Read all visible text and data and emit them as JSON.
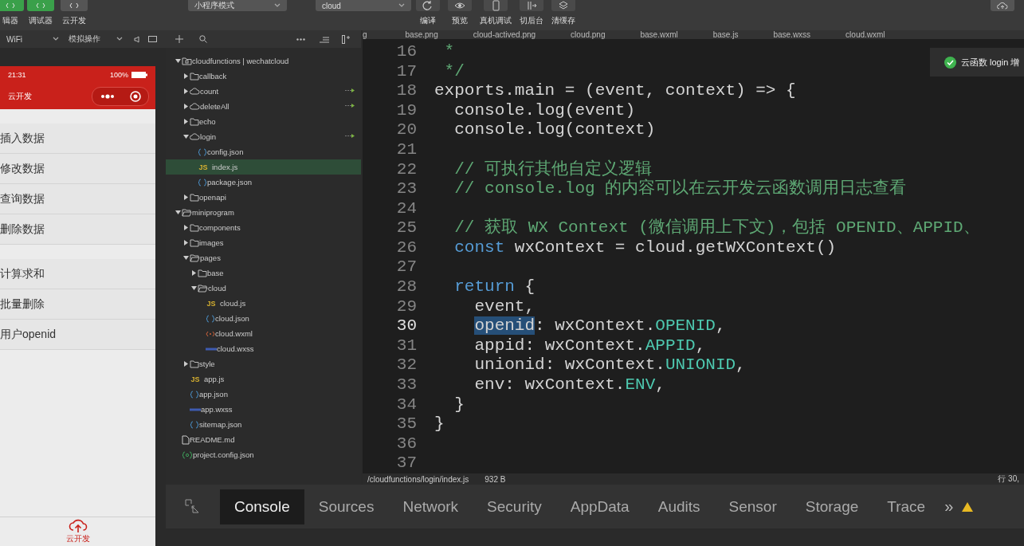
{
  "toolbar": {
    "buttons": [
      {
        "label": "辑器",
        "kind": "green"
      },
      {
        "label": "调试器",
        "kind": "green"
      },
      {
        "label": "云开发",
        "kind": "gray"
      }
    ],
    "mode_select": {
      "value": "小程序模式"
    },
    "compile_select": {
      "value": "cloud"
    },
    "actions": [
      {
        "label": "编译",
        "kind": "refresh"
      },
      {
        "label": "预览",
        "kind": "eye"
      },
      {
        "label": "真机调试",
        "kind": "phone"
      },
      {
        "label": "切后台",
        "kind": "switch"
      },
      {
        "label": "清缓存",
        "kind": "stack"
      }
    ]
  },
  "simulator": {
    "network_select": {
      "value": "WiFi"
    },
    "operation_select": {
      "value": "模拟操作"
    },
    "phone": {
      "time": "21:31",
      "battery": "100%",
      "title": "云开发",
      "groups": [
        {
          "items": [
            "插入数据",
            "修改数据",
            "查询数据",
            "删除数据"
          ]
        },
        {
          "items": [
            "计算求和",
            "批量删除",
            "用户openid"
          ]
        }
      ],
      "tab_label": "云开发"
    }
  },
  "tree": [
    {
      "name": "cloudfunctions | wechatcloud",
      "kind": "root",
      "expanded": true,
      "selected": false,
      "children": [
        {
          "name": "callback",
          "kind": "folder",
          "expanded": false,
          "selected": false
        },
        {
          "name": "count",
          "kind": "cloud",
          "expanded": false,
          "selected": false
        },
        {
          "name": "deleteAll",
          "kind": "cloud",
          "expanded": false,
          "selected": false
        },
        {
          "name": "echo",
          "kind": "folder",
          "expanded": false,
          "selected": false
        },
        {
          "name": "login",
          "kind": "cloud",
          "expanded": true,
          "selected": false,
          "children": [
            {
              "name": "config.json",
              "kind": "json",
              "selected": false
            },
            {
              "name": "index.js",
              "kind": "js",
              "icon_text": "JS",
              "selected": true
            },
            {
              "name": "package.json",
              "kind": "json",
              "selected": false
            }
          ]
        },
        {
          "name": "openapi",
          "kind": "folder",
          "expanded": false,
          "selected": false
        }
      ]
    },
    {
      "name": "miniprogram",
      "kind": "folder",
      "expanded": true,
      "selected": false,
      "children": [
        {
          "name": "components",
          "kind": "folder",
          "expanded": false,
          "selected": false
        },
        {
          "name": "images",
          "kind": "folder",
          "expanded": false,
          "selected": false
        },
        {
          "name": "pages",
          "kind": "folder",
          "expanded": true,
          "selected": false,
          "children": [
            {
              "name": "base",
              "kind": "folder",
              "expanded": false,
              "selected": false
            },
            {
              "name": "cloud",
              "kind": "folder",
              "expanded": true,
              "selected": false,
              "children": [
                {
                  "name": "cloud.js",
                  "kind": "js",
                  "icon_text": "JS",
                  "selected": false
                },
                {
                  "name": "cloud.json",
                  "kind": "json",
                  "selected": false
                },
                {
                  "name": "cloud.wxml",
                  "kind": "wxml",
                  "selected": false
                },
                {
                  "name": "cloud.wxss",
                  "kind": "wxss",
                  "selected": false
                }
              ]
            }
          ]
        },
        {
          "name": "style",
          "kind": "folder",
          "expanded": false,
          "selected": false
        },
        {
          "name": "app.js",
          "kind": "js",
          "icon_text": "JS",
          "selected": false
        },
        {
          "name": "app.json",
          "kind": "json",
          "selected": false
        },
        {
          "name": "app.wxss",
          "kind": "wxss",
          "selected": false
        },
        {
          "name": "sitemap.json",
          "kind": "json",
          "selected": false
        }
      ]
    },
    {
      "name": "README.md",
      "kind": "md",
      "selected": false
    },
    {
      "name": "project.config.json",
      "kind": "config",
      "selected": false
    }
  ],
  "editor": {
    "tabs": [
      "g",
      "base.png",
      "cloud-actived.png",
      "cloud.png",
      "base.wxml",
      "base.js",
      "base.wxss",
      "cloud.wxml"
    ],
    "lines": [
      {
        "number": "16",
        "current": false,
        "tokens": [
          {
            "kind": "comment",
            "text": " *"
          }
        ]
      },
      {
        "number": "17",
        "current": false,
        "tokens": [
          {
            "kind": "comment",
            "text": " */"
          }
        ]
      },
      {
        "number": "18",
        "current": false,
        "tokens": [
          {
            "kind": "plain",
            "text": "exports.main = (event, context) => {"
          }
        ]
      },
      {
        "number": "19",
        "current": false,
        "tokens": [
          {
            "kind": "plain",
            "text": "  console.log(event)"
          }
        ]
      },
      {
        "number": "20",
        "current": false,
        "tokens": [
          {
            "kind": "plain",
            "text": "  console.log(context)"
          }
        ]
      },
      {
        "number": "21",
        "current": false
      },
      {
        "number": "22",
        "current": false,
        "tokens": [
          {
            "kind": "comment",
            "text": "  // 可执行其他自定义逻辑"
          }
        ]
      },
      {
        "number": "23",
        "current": false,
        "tokens": [
          {
            "kind": "comment",
            "text": "  // console.log 的内容可以在云开发云函数调用日志查看"
          }
        ]
      },
      {
        "number": "24",
        "current": false
      },
      {
        "number": "25",
        "current": false,
        "tokens": [
          {
            "kind": "comment",
            "text": "  // 获取 WX Context (微信调用上下文)，包括 OPENID、APPID、"
          }
        ]
      },
      {
        "number": "26",
        "current": false,
        "tokens": [
          {
            "kind": "keyword",
            "text": "  const"
          },
          {
            "kind": "plain",
            "text": " wxContext = cloud.getWXContext()"
          }
        ]
      },
      {
        "number": "27",
        "current": false
      },
      {
        "number": "28",
        "current": false,
        "tokens": [
          {
            "kind": "keyword",
            "text": "  return"
          },
          {
            "kind": "plain",
            "text": " {"
          }
        ]
      },
      {
        "number": "29",
        "current": false,
        "tokens": [
          {
            "kind": "plain",
            "text": "    event,"
          }
        ]
      },
      {
        "number": "30",
        "current": true,
        "tokens": [
          {
            "kind": "highlight",
            "text": "    openid"
          },
          {
            "kind": "plain",
            "text": ": wxContext."
          },
          {
            "kind": "constant",
            "text": "OPENID"
          },
          {
            "kind": "plain",
            "text": ","
          }
        ]
      },
      {
        "number": "31",
        "current": false,
        "tokens": [
          {
            "kind": "plain",
            "text": "    appid: wxContext."
          },
          {
            "kind": "constant",
            "text": "APPID"
          },
          {
            "kind": "plain",
            "text": ","
          }
        ]
      },
      {
        "number": "32",
        "current": false,
        "tokens": [
          {
            "kind": "plain",
            "text": "    unionid: wxContext."
          },
          {
            "kind": "constant",
            "text": "UNIONID"
          },
          {
            "kind": "plain",
            "text": ","
          }
        ]
      },
      {
        "number": "33",
        "current": false,
        "tokens": [
          {
            "kind": "plain",
            "text": "    env: wxContext."
          },
          {
            "kind": "constant",
            "text": "ENV"
          },
          {
            "kind": "plain",
            "text": ","
          }
        ]
      },
      {
        "number": "34",
        "current": false,
        "tokens": [
          {
            "kind": "plain",
            "text": "  }"
          }
        ]
      },
      {
        "number": "35",
        "current": false,
        "tokens": [
          {
            "kind": "plain",
            "text": "}"
          }
        ]
      },
      {
        "number": "36",
        "current": false
      },
      {
        "number": "37",
        "current": false
      }
    ],
    "status_bar": {
      "path": "/cloudfunctions/login/index.js",
      "size": "932 B",
      "position": "行 30,"
    }
  },
  "toast": {
    "message": "云函数 login 增"
  },
  "devtools": {
    "tabs": [
      {
        "label": "Console",
        "selected": true
      },
      {
        "label": "Sources",
        "selected": false
      },
      {
        "label": "Network",
        "selected": false
      },
      {
        "label": "Security",
        "selected": false
      },
      {
        "label": "AppData",
        "selected": false
      },
      {
        "label": "Audits",
        "selected": false
      },
      {
        "label": "Sensor",
        "selected": false
      },
      {
        "label": "Storage",
        "selected": false
      },
      {
        "label": "Trace",
        "selected": false
      }
    ],
    "more": "»"
  }
}
